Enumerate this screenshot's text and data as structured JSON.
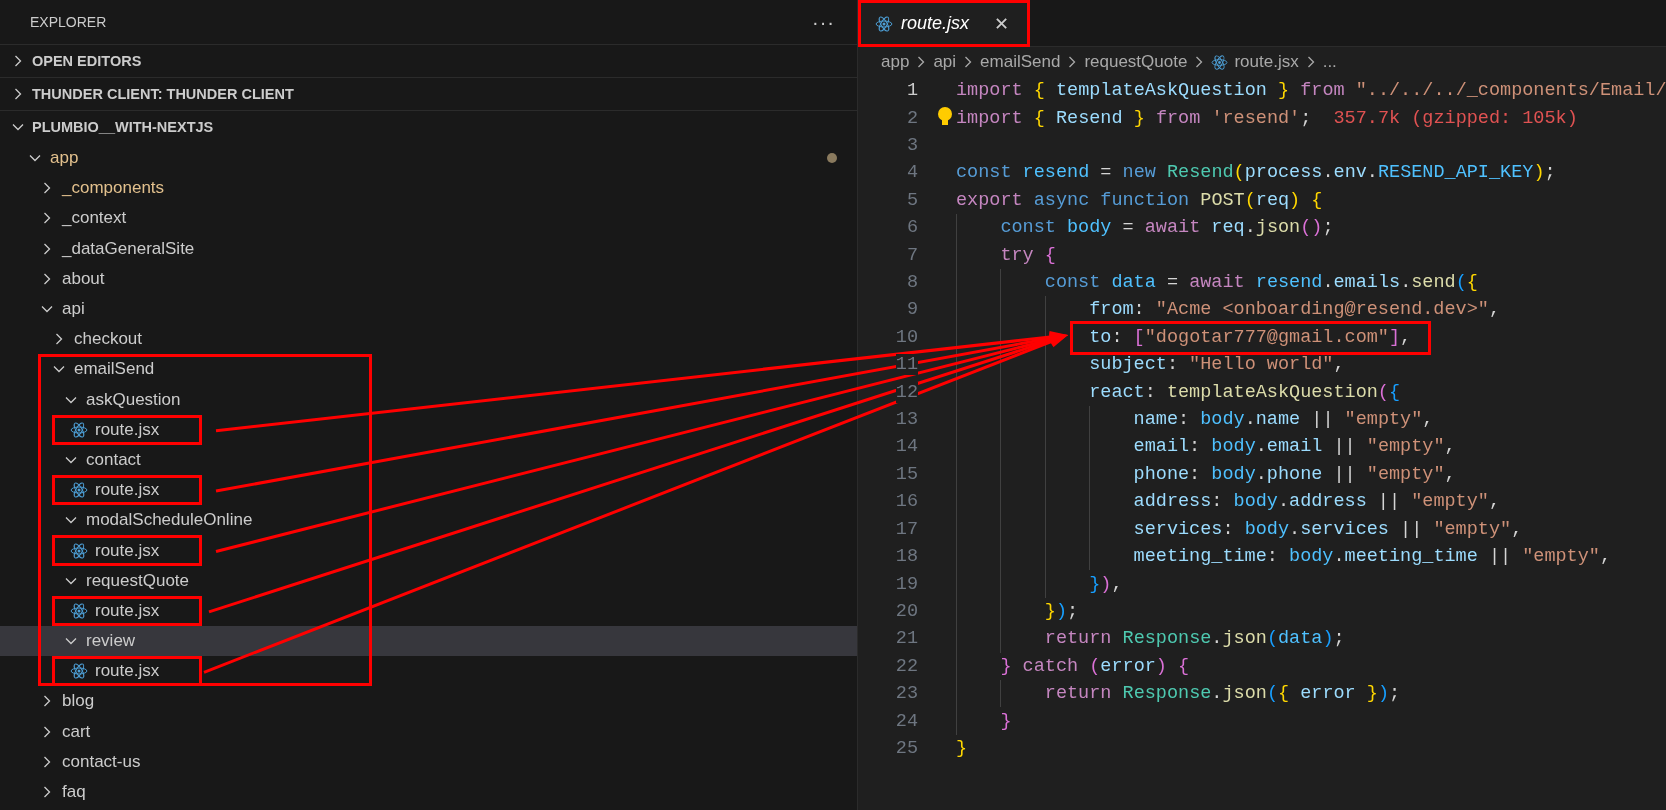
{
  "sidebar": {
    "title": "EXPLORER",
    "more": "···",
    "sections": [
      {
        "title": "OPEN EDITORS",
        "expanded": false
      },
      {
        "title": "THUNDER CLIENT: THUNDER CLIENT",
        "expanded": false
      },
      {
        "title": "PLUMBIO__WITH-NEXTJS",
        "expanded": true
      }
    ],
    "tree": {
      "label": "app",
      "kind": "folder",
      "expanded": true,
      "modified": true,
      "hovered": false,
      "highlighted": false,
      "children": [
        {
          "label": "_components",
          "kind": "folder",
          "expanded": false,
          "modified": true,
          "hovered": false,
          "highlighted": false
        },
        {
          "label": "_context",
          "kind": "folder",
          "expanded": false,
          "modified": false,
          "hovered": false,
          "highlighted": false
        },
        {
          "label": "_dataGeneralSite",
          "kind": "folder",
          "expanded": false,
          "modified": false,
          "hovered": false,
          "highlighted": false
        },
        {
          "label": "about",
          "kind": "folder",
          "expanded": false,
          "modified": false,
          "hovered": false,
          "highlighted": false
        },
        {
          "label": "api",
          "kind": "folder",
          "expanded": true,
          "modified": false,
          "hovered": false,
          "highlighted": false,
          "children": [
            {
              "label": "checkout",
              "kind": "folder",
              "expanded": false,
              "modified": false,
              "hovered": false,
              "highlighted": false
            },
            {
              "label": "emailSend",
              "kind": "folder",
              "expanded": true,
              "modified": false,
              "hovered": false,
              "highlighted": true,
              "children": [
                {
                  "label": "askQuestion",
                  "kind": "folder",
                  "expanded": true,
                  "modified": false,
                  "hovered": false,
                  "highlighted": false,
                  "children": [
                    {
                      "label": "route.jsx",
                      "kind": "file",
                      "modified": false,
                      "hovered": false,
                      "highlighted": true
                    }
                  ]
                },
                {
                  "label": "contact",
                  "kind": "folder",
                  "expanded": true,
                  "modified": false,
                  "hovered": false,
                  "highlighted": false,
                  "children": [
                    {
                      "label": "route.jsx",
                      "kind": "file",
                      "modified": false,
                      "hovered": false,
                      "highlighted": true
                    }
                  ]
                },
                {
                  "label": "modalScheduleOnline",
                  "kind": "folder",
                  "expanded": true,
                  "modified": false,
                  "hovered": false,
                  "highlighted": false,
                  "children": [
                    {
                      "label": "route.jsx",
                      "kind": "file",
                      "modified": false,
                      "hovered": false,
                      "highlighted": true
                    }
                  ]
                },
                {
                  "label": "requestQuote",
                  "kind": "folder",
                  "expanded": true,
                  "modified": false,
                  "hovered": false,
                  "highlighted": false,
                  "children": [
                    {
                      "label": "route.jsx",
                      "kind": "file",
                      "modified": false,
                      "hovered": false,
                      "highlighted": true
                    }
                  ]
                },
                {
                  "label": "review",
                  "kind": "folder",
                  "expanded": true,
                  "modified": false,
                  "hovered": true,
                  "highlighted": false,
                  "children": [
                    {
                      "label": "route.jsx",
                      "kind": "file",
                      "modified": false,
                      "hovered": false,
                      "highlighted": true
                    }
                  ]
                }
              ]
            }
          ]
        },
        {
          "label": "blog",
          "kind": "folder",
          "expanded": false,
          "modified": false,
          "hovered": false,
          "highlighted": false
        },
        {
          "label": "cart",
          "kind": "folder",
          "expanded": false,
          "modified": false,
          "hovered": false,
          "highlighted": false
        },
        {
          "label": "contact-us",
          "kind": "folder",
          "expanded": false,
          "modified": false,
          "hovered": false,
          "highlighted": false
        },
        {
          "label": "faq",
          "kind": "folder",
          "expanded": false,
          "modified": false,
          "hovered": false,
          "highlighted": false
        }
      ]
    }
  },
  "editor": {
    "tabs": [
      {
        "label": "route.jsx",
        "selected": true,
        "highlighted": true,
        "close": "✕"
      }
    ],
    "breadcrumb": [
      {
        "label": "app",
        "kind": "folder"
      },
      {
        "label": "api",
        "kind": "folder"
      },
      {
        "label": "emailSend",
        "kind": "folder"
      },
      {
        "label": "requestQuote",
        "kind": "folder"
      },
      {
        "label": "route.jsx",
        "kind": "file"
      },
      {
        "label": "...",
        "kind": "more"
      }
    ],
    "lines": [
      {
        "number": "1",
        "current": true,
        "lightbulb": false,
        "highlighted": false,
        "tokens": [
          {
            "kind": "kw",
            "text": "import"
          },
          {
            "kind": "br1",
            "text": " {"
          },
          {
            "kind": "var",
            "text": " templateAskQuestion "
          },
          {
            "kind": "br1",
            "text": "}"
          },
          {
            "kind": "kw",
            "text": " from"
          },
          {
            "kind": "str",
            "text": " \"../../../_components/Email/"
          }
        ]
      },
      {
        "number": "2",
        "current": false,
        "lightbulb": true,
        "highlighted": false,
        "tokens": [
          {
            "kind": "kw",
            "text": "import"
          },
          {
            "kind": "br1",
            "text": " {"
          },
          {
            "kind": "var",
            "text": " Resend "
          },
          {
            "kind": "br1",
            "text": "}"
          },
          {
            "kind": "kw",
            "text": " from"
          },
          {
            "kind": "str",
            "text": " 'resend'"
          },
          {
            "kind": "punc",
            "text": ";"
          }
        ],
        "hint": "357.7k (gzipped: 105k)"
      },
      {
        "number": "3",
        "current": false,
        "lightbulb": false,
        "highlighted": false
      },
      {
        "number": "4",
        "current": false,
        "lightbulb": false,
        "highlighted": false,
        "tokens": [
          {
            "kind": "st",
            "text": "const"
          },
          {
            "kind": "const",
            "text": " resend"
          },
          {
            "kind": "punc",
            "text": " ="
          },
          {
            "kind": "st",
            "text": " new"
          },
          {
            "kind": "class",
            "text": " Resend"
          },
          {
            "kind": "br1",
            "text": "("
          },
          {
            "kind": "var",
            "text": "process"
          },
          {
            "kind": "punc",
            "text": "."
          },
          {
            "kind": "var",
            "text": "env"
          },
          {
            "kind": "punc",
            "text": "."
          },
          {
            "kind": "const",
            "text": "RESEND_API_KEY"
          },
          {
            "kind": "br1",
            "text": ")"
          },
          {
            "kind": "punc",
            "text": ";"
          }
        ]
      },
      {
        "number": "5",
        "current": false,
        "lightbulb": false,
        "highlighted": false,
        "tokens": [
          {
            "kind": "kw",
            "text": "export"
          },
          {
            "kind": "st",
            "text": " async"
          },
          {
            "kind": "st",
            "text": " function"
          },
          {
            "kind": "fn",
            "text": " POST"
          },
          {
            "kind": "br1",
            "text": "("
          },
          {
            "kind": "var",
            "text": "req"
          },
          {
            "kind": "br1",
            "text": ")"
          },
          {
            "kind": "br1",
            "text": " {"
          }
        ]
      },
      {
        "number": "6",
        "current": false,
        "lightbulb": false,
        "highlighted": false,
        "tokens": [
          {
            "kind": "st",
            "text": "    const"
          },
          {
            "kind": "const",
            "text": " body"
          },
          {
            "kind": "punc",
            "text": " ="
          },
          {
            "kind": "kw",
            "text": " await"
          },
          {
            "kind": "var",
            "text": " req"
          },
          {
            "kind": "punc",
            "text": "."
          },
          {
            "kind": "fn",
            "text": "json"
          },
          {
            "kind": "br2",
            "text": "()"
          },
          {
            "kind": "punc",
            "text": ";"
          }
        ]
      },
      {
        "number": "7",
        "current": false,
        "lightbulb": false,
        "highlighted": false,
        "tokens": [
          {
            "kind": "kw",
            "text": "    try"
          },
          {
            "kind": "br2",
            "text": " {"
          }
        ]
      },
      {
        "number": "8",
        "current": false,
        "lightbulb": false,
        "highlighted": false,
        "tokens": [
          {
            "kind": "st",
            "text": "        const"
          },
          {
            "kind": "const",
            "text": " data"
          },
          {
            "kind": "punc",
            "text": " ="
          },
          {
            "kind": "kw",
            "text": " await"
          },
          {
            "kind": "const",
            "text": " resend"
          },
          {
            "kind": "punc",
            "text": "."
          },
          {
            "kind": "var",
            "text": "emails"
          },
          {
            "kind": "punc",
            "text": "."
          },
          {
            "kind": "fn",
            "text": "send"
          },
          {
            "kind": "br3",
            "text": "("
          },
          {
            "kind": "br1",
            "text": "{"
          }
        ]
      },
      {
        "number": "9",
        "current": false,
        "lightbulb": false,
        "highlighted": false,
        "tokens": [
          {
            "kind": "var",
            "text": "            from"
          },
          {
            "kind": "punc",
            "text": ":"
          },
          {
            "kind": "str",
            "text": " \"Acme <onboarding@resend.dev>\""
          },
          {
            "kind": "punc",
            "text": ","
          }
        ]
      },
      {
        "number": "10",
        "current": false,
        "lightbulb": false,
        "highlighted": true,
        "tokens": [
          {
            "kind": "var",
            "text": "            to"
          },
          {
            "kind": "punc",
            "text": ":"
          },
          {
            "kind": "br2",
            "text": " ["
          },
          {
            "kind": "str",
            "text": "\"dogotar777@gmail.com\""
          },
          {
            "kind": "br2",
            "text": "]"
          },
          {
            "kind": "punc",
            "text": ","
          }
        ]
      },
      {
        "number": "11",
        "current": false,
        "lightbulb": false,
        "highlighted": false,
        "tokens": [
          {
            "kind": "var",
            "text": "            subject"
          },
          {
            "kind": "punc",
            "text": ":"
          },
          {
            "kind": "str",
            "text": " \"Hello world\""
          },
          {
            "kind": "punc",
            "text": ","
          }
        ]
      },
      {
        "number": "12",
        "current": false,
        "lightbulb": false,
        "highlighted": false,
        "tokens": [
          {
            "kind": "var",
            "text": "            react"
          },
          {
            "kind": "punc",
            "text": ":"
          },
          {
            "kind": "fn",
            "text": " templateAskQuestion"
          },
          {
            "kind": "br2",
            "text": "("
          },
          {
            "kind": "br3",
            "text": "{"
          }
        ]
      },
      {
        "number": "13",
        "current": false,
        "lightbulb": false,
        "highlighted": false,
        "tokens": [
          {
            "kind": "var",
            "text": "                name"
          },
          {
            "kind": "punc",
            "text": ":"
          },
          {
            "kind": "const",
            "text": " body"
          },
          {
            "kind": "punc",
            "text": "."
          },
          {
            "kind": "var",
            "text": "name"
          },
          {
            "kind": "punc",
            "text": " ||"
          },
          {
            "kind": "str",
            "text": " \"empty\""
          },
          {
            "kind": "punc",
            "text": ","
          }
        ]
      },
      {
        "number": "14",
        "current": false,
        "lightbulb": false,
        "highlighted": false,
        "tokens": [
          {
            "kind": "var",
            "text": "                email"
          },
          {
            "kind": "punc",
            "text": ":"
          },
          {
            "kind": "const",
            "text": " body"
          },
          {
            "kind": "punc",
            "text": "."
          },
          {
            "kind": "var",
            "text": "email"
          },
          {
            "kind": "punc",
            "text": " ||"
          },
          {
            "kind": "str",
            "text": " \"empty\""
          },
          {
            "kind": "punc",
            "text": ","
          }
        ]
      },
      {
        "number": "15",
        "current": false,
        "lightbulb": false,
        "highlighted": false,
        "tokens": [
          {
            "kind": "var",
            "text": "                phone"
          },
          {
            "kind": "punc",
            "text": ":"
          },
          {
            "kind": "const",
            "text": " body"
          },
          {
            "kind": "punc",
            "text": "."
          },
          {
            "kind": "var",
            "text": "phone"
          },
          {
            "kind": "punc",
            "text": " ||"
          },
          {
            "kind": "str",
            "text": " \"empty\""
          },
          {
            "kind": "punc",
            "text": ","
          }
        ]
      },
      {
        "number": "16",
        "current": false,
        "lightbulb": false,
        "highlighted": false,
        "tokens": [
          {
            "kind": "var",
            "text": "                address"
          },
          {
            "kind": "punc",
            "text": ":"
          },
          {
            "kind": "const",
            "text": " body"
          },
          {
            "kind": "punc",
            "text": "."
          },
          {
            "kind": "var",
            "text": "address"
          },
          {
            "kind": "punc",
            "text": " ||"
          },
          {
            "kind": "str",
            "text": " \"empty\""
          },
          {
            "kind": "punc",
            "text": ","
          }
        ]
      },
      {
        "number": "17",
        "current": false,
        "lightbulb": false,
        "highlighted": false,
        "tokens": [
          {
            "kind": "var",
            "text": "                services"
          },
          {
            "kind": "punc",
            "text": ":"
          },
          {
            "kind": "const",
            "text": " body"
          },
          {
            "kind": "punc",
            "text": "."
          },
          {
            "kind": "var",
            "text": "services"
          },
          {
            "kind": "punc",
            "text": " ||"
          },
          {
            "kind": "str",
            "text": " \"empty\""
          },
          {
            "kind": "punc",
            "text": ","
          }
        ]
      },
      {
        "number": "18",
        "current": false,
        "lightbulb": false,
        "highlighted": false,
        "tokens": [
          {
            "kind": "var",
            "text": "                meeting_time"
          },
          {
            "kind": "punc",
            "text": ":"
          },
          {
            "kind": "const",
            "text": " body"
          },
          {
            "kind": "punc",
            "text": "."
          },
          {
            "kind": "var",
            "text": "meeting_time"
          },
          {
            "kind": "punc",
            "text": " ||"
          },
          {
            "kind": "str",
            "text": " \"empty\""
          },
          {
            "kind": "punc",
            "text": ","
          }
        ]
      },
      {
        "number": "19",
        "current": false,
        "lightbulb": false,
        "highlighted": false,
        "tokens": [
          {
            "kind": "br3",
            "text": "            }"
          },
          {
            "kind": "br2",
            "text": ")"
          },
          {
            "kind": "punc",
            "text": ","
          }
        ]
      },
      {
        "number": "20",
        "current": false,
        "lightbulb": false,
        "highlighted": false,
        "tokens": [
          {
            "kind": "br1",
            "text": "        }"
          },
          {
            "kind": "br3",
            "text": ")"
          },
          {
            "kind": "punc",
            "text": ";"
          }
        ]
      },
      {
        "number": "21",
        "current": false,
        "lightbulb": false,
        "highlighted": false,
        "tokens": [
          {
            "kind": "kw",
            "text": "        return"
          },
          {
            "kind": "class",
            "text": " Response"
          },
          {
            "kind": "punc",
            "text": "."
          },
          {
            "kind": "fn",
            "text": "json"
          },
          {
            "kind": "br3",
            "text": "("
          },
          {
            "kind": "const",
            "text": "data"
          },
          {
            "kind": "br3",
            "text": ")"
          },
          {
            "kind": "punc",
            "text": ";"
          }
        ]
      },
      {
        "number": "22",
        "current": false,
        "lightbulb": false,
        "highlighted": false,
        "tokens": [
          {
            "kind": "br2",
            "text": "    }"
          },
          {
            "kind": "kw",
            "text": " catch"
          },
          {
            "kind": "br2",
            "text": " ("
          },
          {
            "kind": "var",
            "text": "error"
          },
          {
            "kind": "br2",
            "text": ")"
          },
          {
            "kind": "br2",
            "text": " {"
          }
        ]
      },
      {
        "number": "23",
        "current": false,
        "lightbulb": false,
        "highlighted": false,
        "tokens": [
          {
            "kind": "kw",
            "text": "        return"
          },
          {
            "kind": "class",
            "text": " Response"
          },
          {
            "kind": "punc",
            "text": "."
          },
          {
            "kind": "fn",
            "text": "json"
          },
          {
            "kind": "br3",
            "text": "("
          },
          {
            "kind": "br1",
            "text": "{"
          },
          {
            "kind": "var",
            "text": " error "
          },
          {
            "kind": "br1",
            "text": "}"
          },
          {
            "kind": "br3",
            "text": ")"
          },
          {
            "kind": "punc",
            "text": ";"
          }
        ]
      },
      {
        "number": "24",
        "current": false,
        "lightbulb": false,
        "highlighted": false,
        "tokens": [
          {
            "kind": "br2",
            "text": "    }"
          }
        ]
      },
      {
        "number": "25",
        "current": false,
        "lightbulb": false,
        "highlighted": false,
        "tokens": [
          {
            "kind": "br1",
            "text": "}"
          }
        ]
      }
    ]
  }
}
